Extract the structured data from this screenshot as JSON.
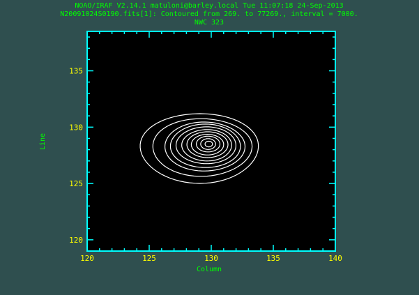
{
  "header": {
    "line1": "NOAO/IRAF V2.14.1 matuloni@barley.local Tue 11:07:18 24-Sep-2013",
    "line2": "N20091024S0190.fits[1]: Contoured from 269. to 77269., interval = 7000.",
    "line3": "NWC 323"
  },
  "colors": {
    "background": "#2f4f4f",
    "plot_background": "#000000",
    "frame": "#00ffff",
    "title_text": "#00ff00",
    "axis_label_text": "#00ff00",
    "tick_label_text": "#ffff00",
    "contour": "#ffffff"
  },
  "chart_data": {
    "type": "contour",
    "xlabel": "Column",
    "ylabel": "Line",
    "xlim": [
      120,
      140
    ],
    "ylim": [
      119,
      138.5
    ],
    "x_ticks": [
      120,
      125,
      130,
      135,
      140
    ],
    "y_ticks": [
      120,
      125,
      130,
      135
    ],
    "contour_min": 269,
    "contour_max": 77269,
    "contour_interval": 7000,
    "peak": {
      "x": 129.8,
      "y": 128.5
    },
    "contours": [
      {
        "level": 269,
        "cx": 129.1,
        "cy": 128.2,
        "rx": 4.7,
        "ry": 3.15,
        "skew": 0.45
      },
      {
        "level": 7269,
        "cx": 129.3,
        "cy": 128.25,
        "rx": 3.95,
        "ry": 2.6,
        "skew": 0.4
      },
      {
        "level": 14269,
        "cx": 129.5,
        "cy": 128.3,
        "rx": 3.2,
        "ry": 2.2,
        "skew": 0.3
      },
      {
        "level": 21269,
        "cx": 129.55,
        "cy": 128.35,
        "rx": 2.8,
        "ry": 1.95,
        "skew": 0.25
      },
      {
        "level": 28269,
        "cx": 129.6,
        "cy": 128.4,
        "rx": 2.4,
        "ry": 1.65,
        "skew": 0.2
      },
      {
        "level": 35269,
        "cx": 129.65,
        "cy": 128.4,
        "rx": 2.0,
        "ry": 1.4,
        "skew": 0.15
      },
      {
        "level": 42269,
        "cx": 129.7,
        "cy": 128.45,
        "rx": 1.65,
        "ry": 1.15,
        "skew": 0.1
      },
      {
        "level": 49269,
        "cx": 129.7,
        "cy": 128.45,
        "rx": 1.3,
        "ry": 0.92,
        "skew": 0.08
      },
      {
        "level": 56269,
        "cx": 129.75,
        "cy": 128.5,
        "rx": 0.95,
        "ry": 0.7,
        "skew": 0.05
      },
      {
        "level": 63269,
        "cx": 129.75,
        "cy": 128.5,
        "rx": 0.6,
        "ry": 0.48,
        "skew": 0.0
      },
      {
        "level": 70269,
        "cx": 129.8,
        "cy": 128.5,
        "rx": 0.3,
        "ry": 0.25,
        "skew": 0.0
      }
    ]
  }
}
